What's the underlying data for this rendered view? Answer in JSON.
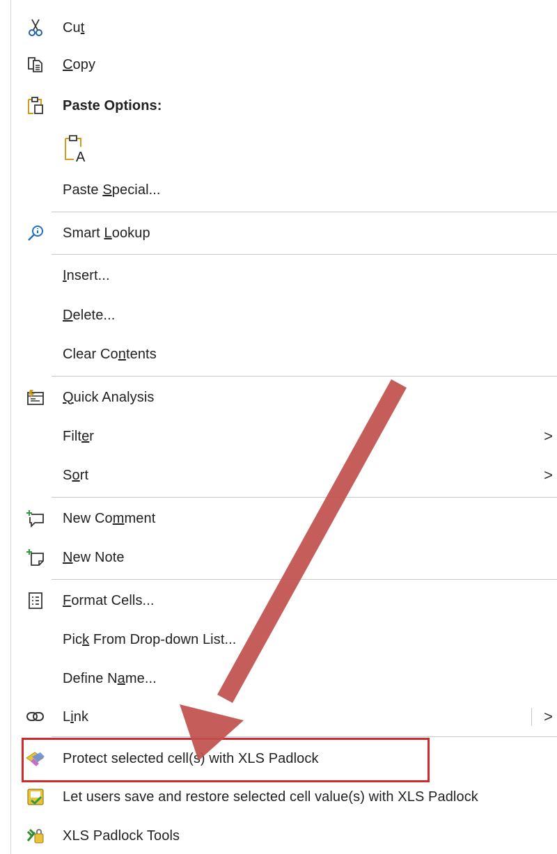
{
  "menu": {
    "cut": {
      "pre": "Cu",
      "key": "t",
      "post": ""
    },
    "copy": {
      "pre": "",
      "key": "C",
      "post": "opy"
    },
    "paste_options": "Paste Options:",
    "paste_special": {
      "pre": "Paste ",
      "key": "S",
      "post": "pecial..."
    },
    "smart_lookup": {
      "pre": "Smart ",
      "key": "L",
      "post": "ookup"
    },
    "insert": {
      "pre": "",
      "key": "I",
      "post": "nsert..."
    },
    "delete": {
      "pre": "",
      "key": "D",
      "post": "elete..."
    },
    "clear_contents": {
      "pre": "Clear Co",
      "key": "n",
      "post": "tents"
    },
    "quick_analysis": {
      "pre": "",
      "key": "Q",
      "post": "uick Analysis"
    },
    "filter": {
      "pre": "Filt",
      "key": "e",
      "post": "r"
    },
    "sort": {
      "pre": "S",
      "key": "o",
      "post": "rt"
    },
    "new_comment": {
      "pre": "New Co",
      "key": "m",
      "post": "ment"
    },
    "new_note": {
      "pre": "",
      "key": "N",
      "post": "ew Note"
    },
    "format_cells": {
      "pre": "",
      "key": "F",
      "post": "ormat Cells..."
    },
    "pick_from_list": {
      "pre": "Pic",
      "key": "k",
      "post": " From Drop-down List..."
    },
    "define_name": {
      "pre": "Define N",
      "key": "a",
      "post": "me..."
    },
    "link": {
      "pre": "L",
      "key": "i",
      "post": "nk"
    },
    "protect_cells": "Protect selected cell(s) with XLS Padlock",
    "save_restore": "Let users save and restore selected cell value(s) with XLS Padlock",
    "xls_tools": "XLS Padlock Tools",
    "submenu_glyph": ">"
  },
  "colors": {
    "highlight_border": "#d12a2a",
    "arrow": "#c0504d"
  },
  "icons": {
    "cut": "scissors-icon",
    "copy": "copy-icon",
    "paste": "clipboard-icon",
    "paste_text": "paste-text-icon",
    "smart_lookup": "search-info-icon",
    "quick_analysis": "quick-analysis-icon",
    "new_comment": "comment-add-icon",
    "new_note": "note-add-icon",
    "format_cells": "format-cells-icon",
    "link": "link-icon",
    "protect": "padlock-protect-icon",
    "save_restore": "save-restore-icon",
    "tools": "xls-padlock-tools-icon"
  }
}
